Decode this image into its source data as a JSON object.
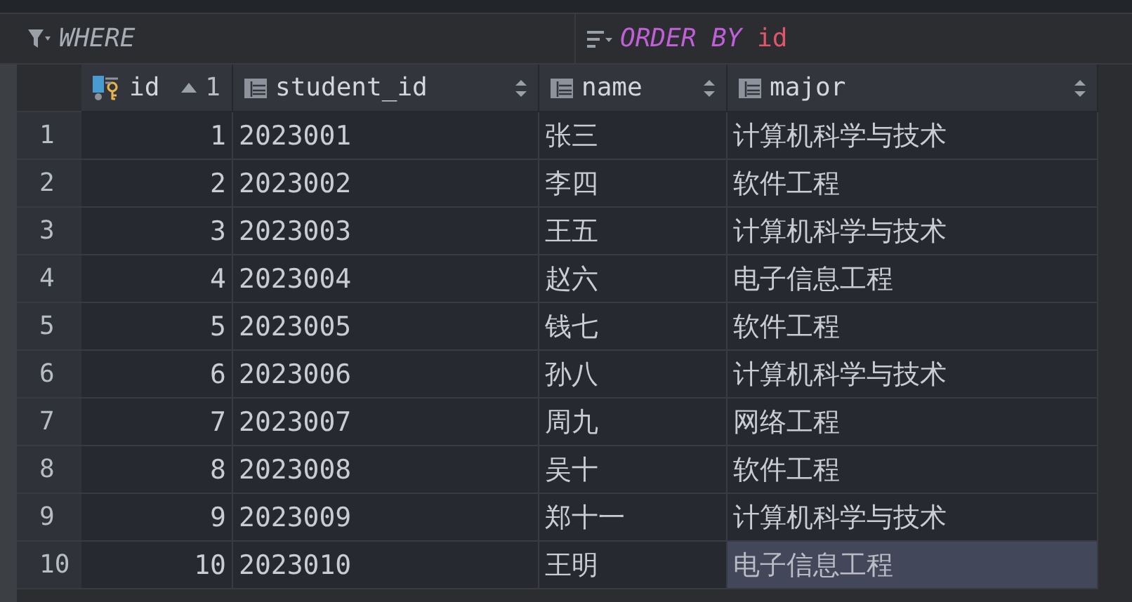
{
  "filter": {
    "where_label": "WHERE",
    "order_keywords": "ORDER BY",
    "order_column": "id"
  },
  "columns": [
    {
      "label": "id",
      "kind": "key",
      "sorted": true,
      "sort_rank": "1"
    },
    {
      "label": "student_id",
      "kind": "plain",
      "sorted": false
    },
    {
      "label": "name",
      "kind": "plain",
      "sorted": false
    },
    {
      "label": "major",
      "kind": "plain",
      "sorted": false
    }
  ],
  "rows": [
    {
      "num": "1",
      "cells": [
        "1",
        "2023001",
        "张三",
        "计算机科学与技术"
      ],
      "selected": false
    },
    {
      "num": "2",
      "cells": [
        "2",
        "2023002",
        "李四",
        "软件工程"
      ],
      "selected": false
    },
    {
      "num": "3",
      "cells": [
        "3",
        "2023003",
        "王五",
        "计算机科学与技术"
      ],
      "selected": false
    },
    {
      "num": "4",
      "cells": [
        "4",
        "2023004",
        "赵六",
        "电子信息工程"
      ],
      "selected": false
    },
    {
      "num": "5",
      "cells": [
        "5",
        "2023005",
        "钱七",
        "软件工程"
      ],
      "selected": false
    },
    {
      "num": "6",
      "cells": [
        "6",
        "2023006",
        "孙八",
        "计算机科学与技术"
      ],
      "selected": false
    },
    {
      "num": "7",
      "cells": [
        "7",
        "2023007",
        "周九",
        "网络工程"
      ],
      "selected": false
    },
    {
      "num": "8",
      "cells": [
        "8",
        "2023008",
        "吴十",
        "软件工程"
      ],
      "selected": false
    },
    {
      "num": "9",
      "cells": [
        "9",
        "2023009",
        "郑十一",
        "计算机科学与技术"
      ],
      "selected": false
    },
    {
      "num": "10",
      "cells": [
        "10",
        "2023010",
        "王明",
        "电子信息工程"
      ],
      "selected": true
    }
  ]
}
